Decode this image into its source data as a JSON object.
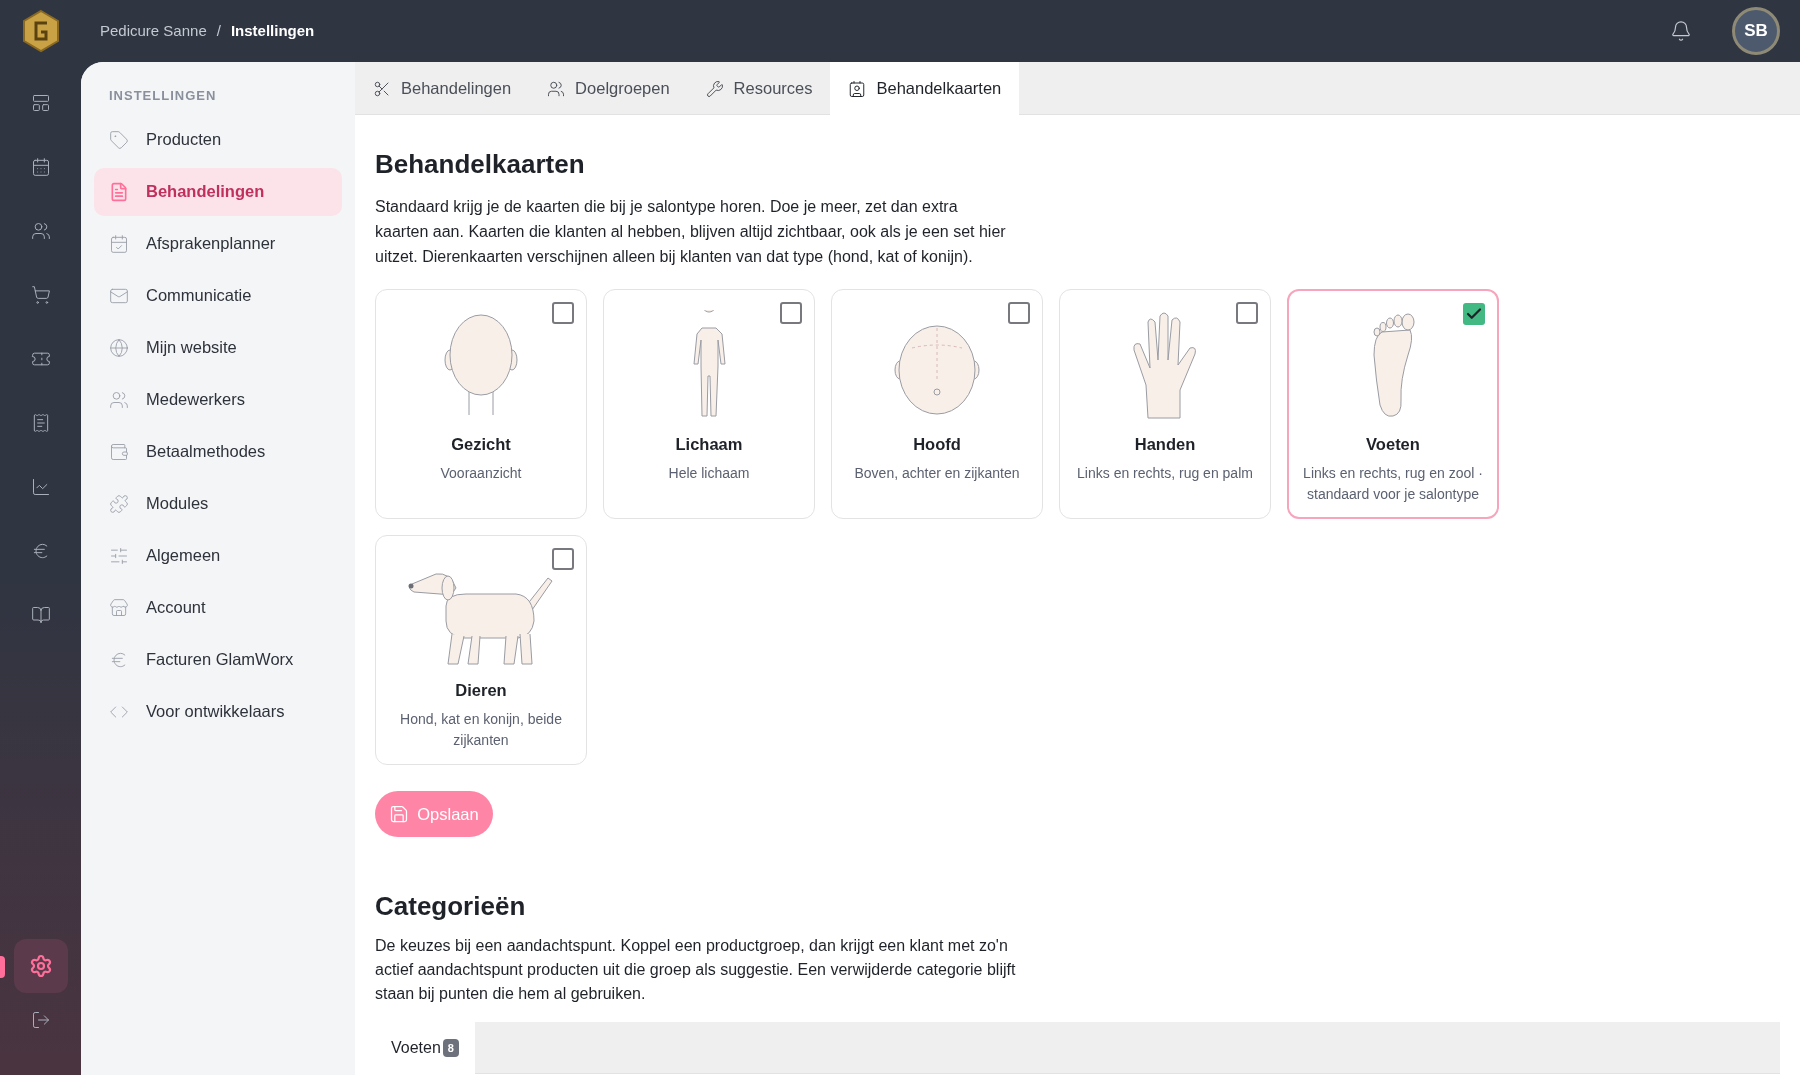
{
  "breadcrumb": {
    "parent": "Pedicure Sanne",
    "separator": "/",
    "current": "Instellingen"
  },
  "user": {
    "initials": "SB"
  },
  "rail": [
    {
      "selected": false
    },
    {
      "selected": false
    },
    {
      "selected": false
    },
    {
      "selected": false
    },
    {
      "selected": false
    },
    {
      "selected": false
    },
    {
      "selected": false
    },
    {
      "selected": false
    },
    {
      "selected": false
    },
    {
      "selected": true
    },
    {
      "selected": false
    }
  ],
  "sidebar": {
    "heading": "INSTELLINGEN",
    "items": [
      {
        "label": "Producten",
        "selected": false
      },
      {
        "label": "Behandelingen",
        "selected": true
      },
      {
        "label": "Afsprakenplanner",
        "selected": false
      },
      {
        "label": "Communicatie",
        "selected": false
      },
      {
        "label": "Mijn website",
        "selected": false
      },
      {
        "label": "Medewerkers",
        "selected": false
      },
      {
        "label": "Betaalmethodes",
        "selected": false
      },
      {
        "label": "Modules",
        "selected": false
      },
      {
        "label": "Algemeen",
        "selected": false
      },
      {
        "label": "Account",
        "selected": false
      },
      {
        "label": "Facturen GlamWorx",
        "selected": false
      },
      {
        "label": "Voor ontwikkelaars",
        "selected": false
      }
    ]
  },
  "tabs": [
    {
      "label": "Behandelingen",
      "selected": false
    },
    {
      "label": "Doelgroepen",
      "selected": false
    },
    {
      "label": "Resources",
      "selected": false
    },
    {
      "label": "Behandelkaarten",
      "selected": true
    }
  ],
  "section": {
    "title": "Behandelkaarten",
    "description": "Standaard krijg je de kaarten die bij je salontype horen. Doe je meer, zet dan extra kaarten aan. Kaarten die klanten al hebben, blijven altijd zichtbaar, ook als je een set hier uitzet. Dierenkaarten verschijnen alleen bij klanten van dat type (hond, kat of konijn).",
    "cards": [
      {
        "kind": "face",
        "title": "Gezicht",
        "subtitle": "Vooraanzicht",
        "checked": false
      },
      {
        "kind": "body",
        "title": "Lichaam",
        "subtitle": "Hele lichaam",
        "checked": false
      },
      {
        "kind": "head",
        "title": "Hoofd",
        "subtitle": "Boven, achter en zijkanten",
        "checked": false
      },
      {
        "kind": "hand",
        "title": "Handen",
        "subtitle": "Links en rechts, rug en palm",
        "checked": false
      },
      {
        "kind": "foot",
        "title": "Voeten",
        "subtitle": "Links en rechts, rug en zool · standaard voor je salontype",
        "checked": true
      },
      {
        "kind": "dog",
        "title": "Dieren",
        "subtitle": "Hond, kat en konijn, beide zijkanten",
        "checked": false
      }
    ],
    "save_button": "Opslaan"
  },
  "categories": {
    "title": "Categorieën",
    "description": "De keuzes bij een aandachtspunt. Koppel een productgroep, dan krijgt een klant met zo'n actief aandachtspunt producten uit die groep als suggestie. Een verwijderde categorie blijft staan bij punten die hem al gebruiken.",
    "tabs": [
      {
        "label": "Voeten",
        "count": "8",
        "selected": true
      }
    ]
  }
}
